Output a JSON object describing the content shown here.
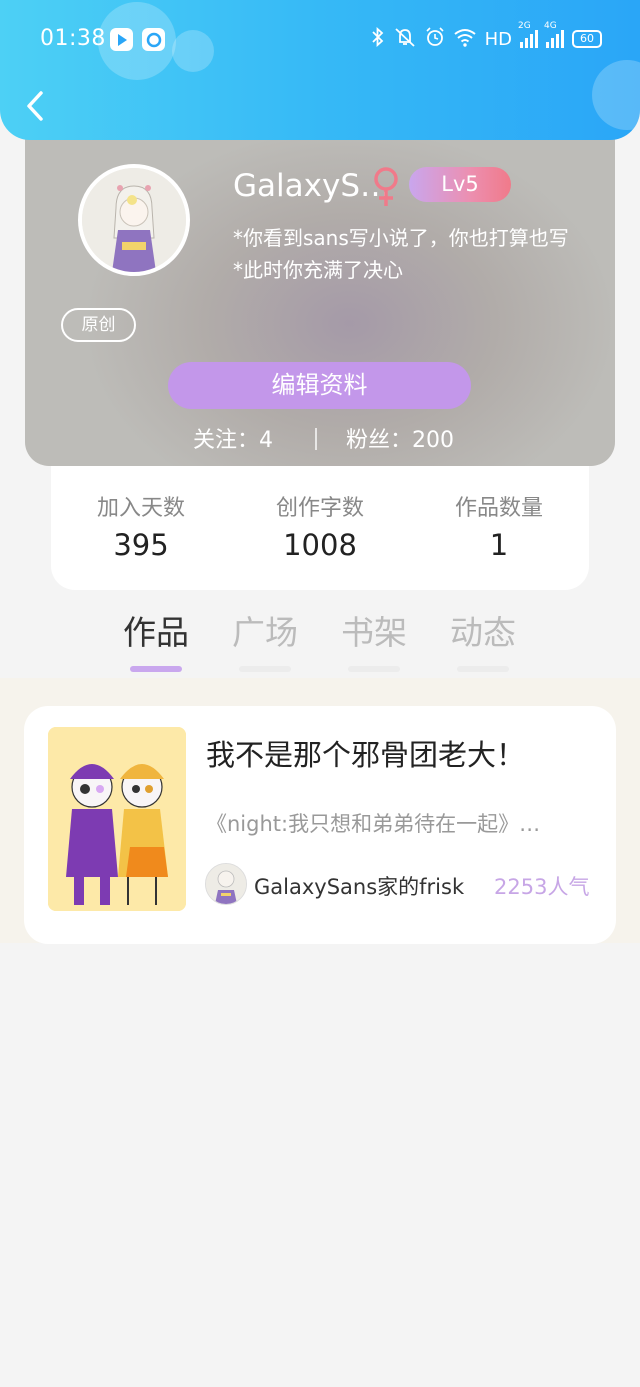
{
  "status_bar": {
    "time": "01:38",
    "network_label": "HD",
    "signal_1_label": "2G",
    "signal_2_label": "4G",
    "battery": "60"
  },
  "profile": {
    "username": "GalaxyS…",
    "level": "Lv5",
    "bio_line1": "*你看到sans写小说了，你也打算也写",
    "bio_line2": "*此时你充满了决心",
    "original_tag": "原创",
    "edit_button": "编辑资料",
    "following": "关注：4",
    "fans": "粉丝：200"
  },
  "stats": [
    {
      "label": "加入天数",
      "value": "395"
    },
    {
      "label": "创作字数",
      "value": "1008"
    },
    {
      "label": "作品数量",
      "value": "1"
    }
  ],
  "tabs": [
    "作品",
    "广场",
    "书架",
    "动态"
  ],
  "work": {
    "title": "我不是那个邪骨团老大！",
    "description": "《night:我只想和弟弟待在一起》…",
    "author": "GalaxySans家的frisk",
    "popularity": "2253人气"
  },
  "colors": {
    "header_gradient_start": "#4dd0f5",
    "header_gradient_end": "#2aa6f7",
    "accent_purple": "#c397ea",
    "level_badge": "#ec8fb0",
    "gender_pink": "#f07a8a"
  }
}
